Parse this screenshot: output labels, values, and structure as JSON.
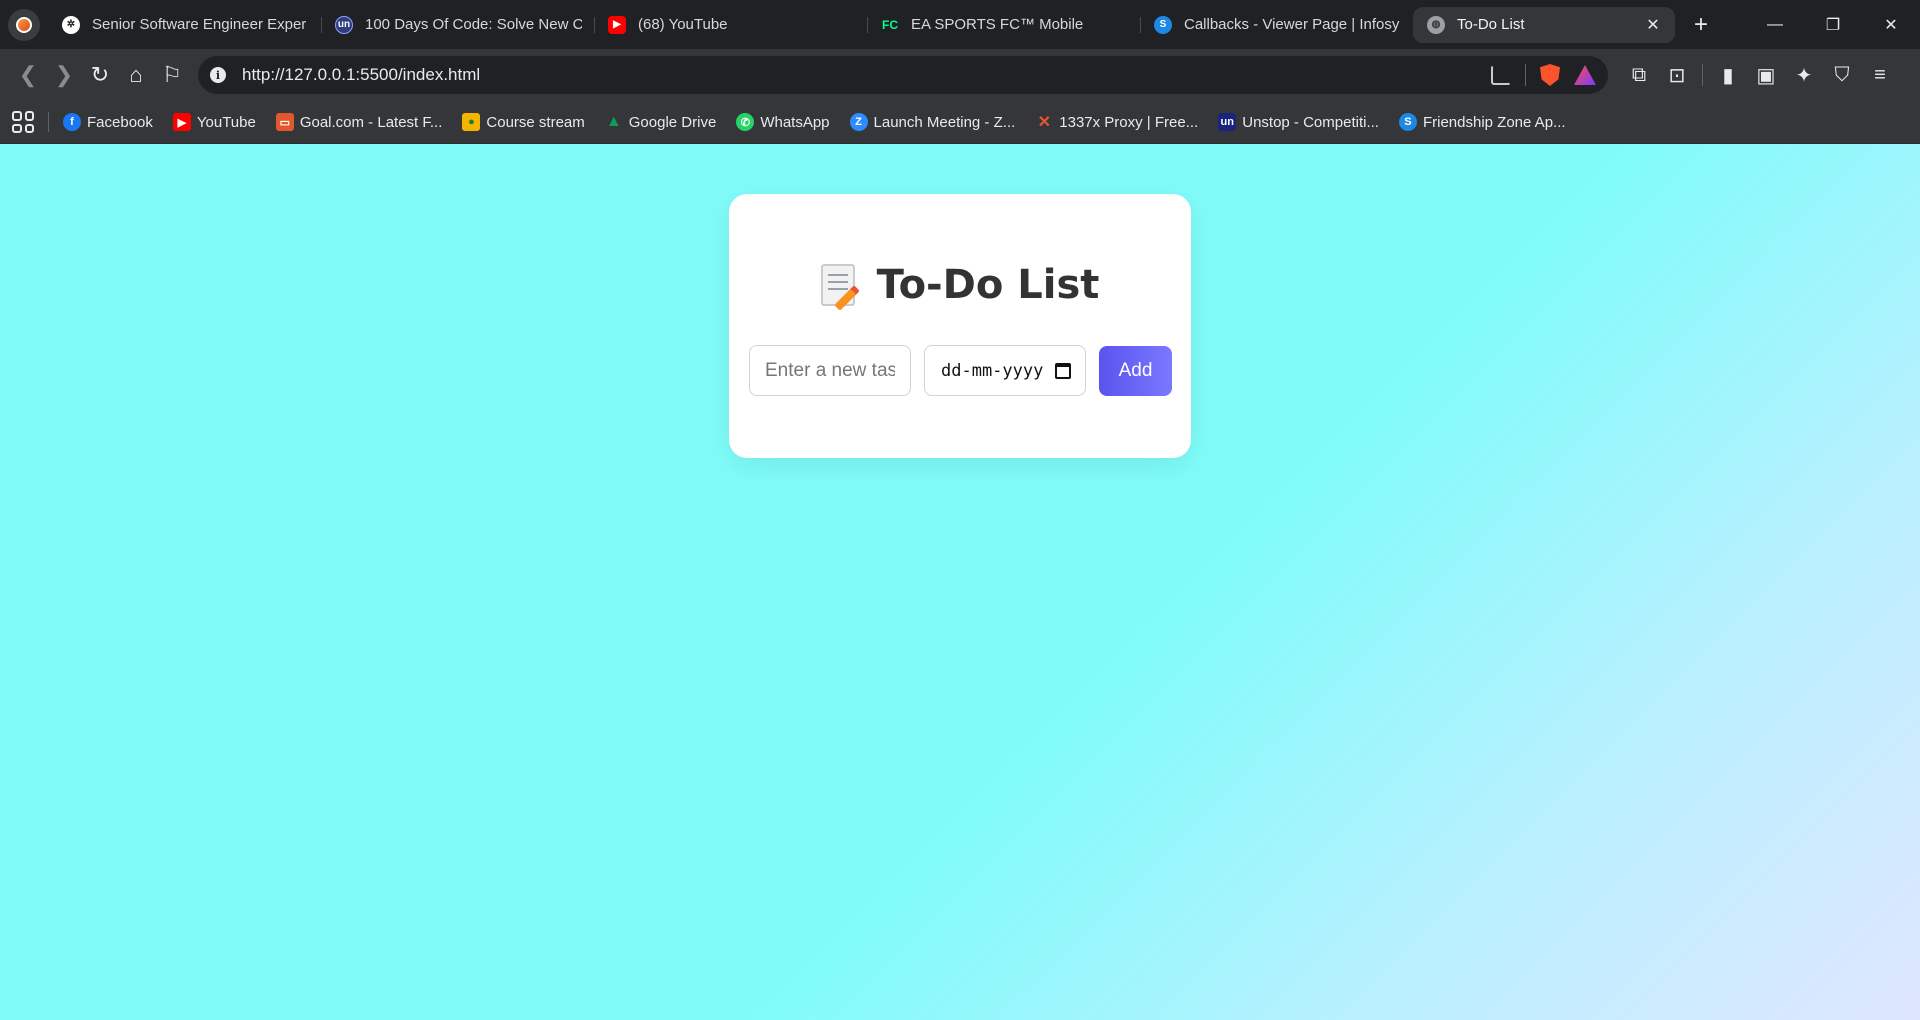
{
  "browser": {
    "tabs": [
      {
        "title": "Senior Software Engineer Exper",
        "icon": "openai-icon",
        "color": "#e8eaed"
      },
      {
        "title": "100 Days Of Code: Solve New C",
        "icon": "unstop-icon",
        "color": "#2f3c7e"
      },
      {
        "title": "(68) YouTube",
        "icon": "youtube-icon",
        "color": "#ff0000"
      },
      {
        "title": "EA SPORTS FC™ Mobile",
        "icon": "ea-fc-icon",
        "color": "#00ff87"
      },
      {
        "title": "Callbacks - Viewer Page | Infosy",
        "icon": "infosys-icon",
        "color": "#1e88e5"
      },
      {
        "title": "To-Do List",
        "icon": "globe-icon",
        "color": "#9aa0a6",
        "active": true
      }
    ],
    "address_bar": {
      "url": "http://127.0.0.1:5500/index.html"
    },
    "bookmarks": [
      {
        "label": "Facebook",
        "icon": "facebook-icon",
        "color": "#1877f2"
      },
      {
        "label": "YouTube",
        "icon": "youtube-icon",
        "color": "#ff0000"
      },
      {
        "label": "Goal.com - Latest F...",
        "icon": "goal-icon",
        "color": "#e4572e"
      },
      {
        "label": "Course stream",
        "icon": "classroom-icon",
        "color": "#f4b400"
      },
      {
        "label": "Google Drive",
        "icon": "google-drive-icon",
        "color": "#0f9d58"
      },
      {
        "label": "WhatsApp",
        "icon": "whatsapp-icon",
        "color": "#25d366"
      },
      {
        "label": "Launch Meeting - Z...",
        "icon": "zoom-icon",
        "color": "#2d8cff"
      },
      {
        "label": "1337x Proxy | Free...",
        "icon": "x-icon",
        "color": "#e4572e"
      },
      {
        "label": "Unstop - Competiti...",
        "icon": "unstop-icon",
        "color": "#1a237e"
      },
      {
        "label": "Friendship Zone Ap...",
        "icon": "friendship-icon",
        "color": "#1e88e5"
      }
    ]
  },
  "page": {
    "title": "To-Do List",
    "task_input": {
      "placeholder": "Enter a new task",
      "value": ""
    },
    "date_input": {
      "placeholder": "dd-mm-yyyy"
    },
    "add_button": "Add",
    "colors": {
      "accent": "#5a54ef",
      "background": "#7ffcf9"
    }
  }
}
